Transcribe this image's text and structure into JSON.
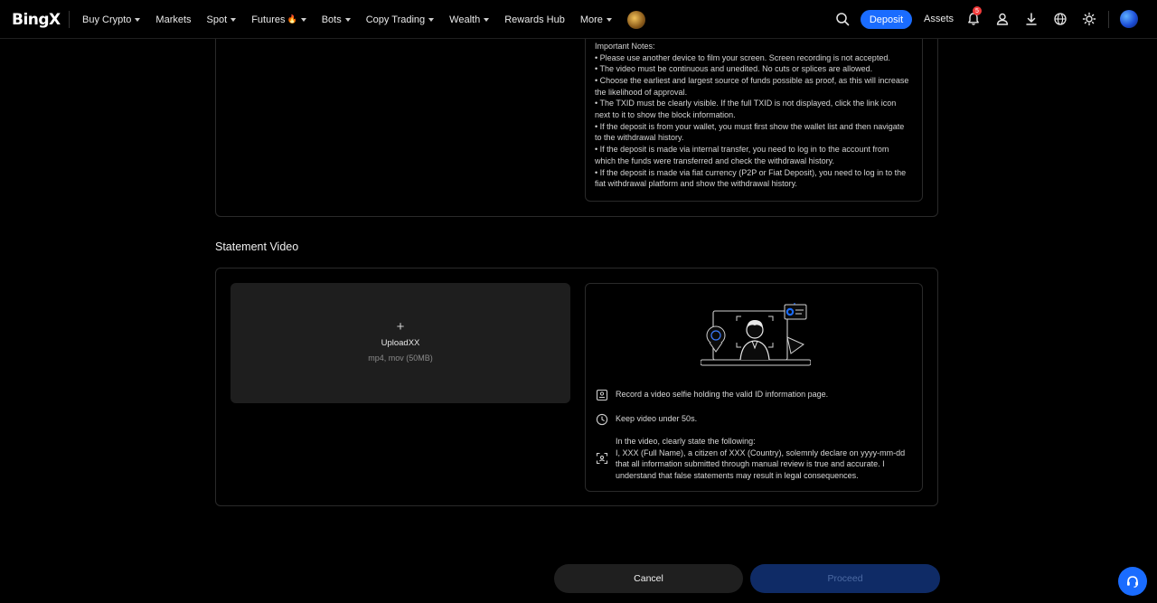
{
  "header": {
    "logo_text": "BingX",
    "nav": [
      {
        "label": "Buy Crypto",
        "has_caret": true
      },
      {
        "label": "Markets",
        "has_caret": false
      },
      {
        "label": "Spot",
        "has_caret": true
      },
      {
        "label": "Futures",
        "has_caret": true,
        "fire_icon": true
      },
      {
        "label": "Bots",
        "has_caret": true
      },
      {
        "label": "Copy Trading",
        "has_caret": true
      },
      {
        "label": "Wealth",
        "has_caret": true
      },
      {
        "label": "Rewards Hub",
        "has_caret": false
      },
      {
        "label": "More",
        "has_caret": true
      }
    ],
    "deposit_label": "Deposit",
    "assets_label": "Assets",
    "notification_count": "5",
    "icons": [
      "search-icon",
      "bell-icon",
      "user-icon",
      "download-icon",
      "globe-icon",
      "sun-icon"
    ]
  },
  "top_notes": {
    "lines": [
      "Important Notes:",
      "• Please use another device to film your screen. Screen recording is not accepted.",
      "• The video must be continuous and unedited. No cuts or splices are allowed.",
      "• Choose the earliest and largest source of funds possible as proof, as this will increase the likelihood of approval.",
      "• The TXID must be clearly visible. If the full TXID is not displayed, click the link icon next to it to show the block information.",
      "• If the deposit is from your wallet, you must first show the wallet list and then navigate to the withdrawal history.",
      "• If the deposit is made via internal transfer, you need to log in to the account from which the funds were transferred and check the withdrawal history.",
      "• If the deposit is made via fiat currency (P2P or Fiat Deposit), you need to log in to the fiat withdrawal platform and show the withdrawal history."
    ]
  },
  "statement_video": {
    "title": "Statement Video",
    "upload": {
      "plus": "+",
      "label": "UploadXX",
      "hint": "mp4, mov (50MB)"
    },
    "guide": [
      {
        "icon": "id-card-icon",
        "text": "Record a video selfie holding the valid ID information page."
      },
      {
        "icon": "clock-icon",
        "text": "Keep video under 50s."
      },
      {
        "icon": "face-scan-icon",
        "text": "In the video, clearly state the following:\nI, XXX (Full Name), a citizen of XXX (Country), solemnly declare on yyyy-mm-dd that all information submitted through manual review is true and accurate. I understand that false statements may result in legal consequences."
      }
    ]
  },
  "actions": {
    "cancel_label": "Cancel",
    "proceed_label": "Proceed"
  },
  "colors": {
    "accent": "#1a6cff",
    "proceed_disabled_bg": "#0f2b66",
    "badge": "#f23b3b"
  }
}
